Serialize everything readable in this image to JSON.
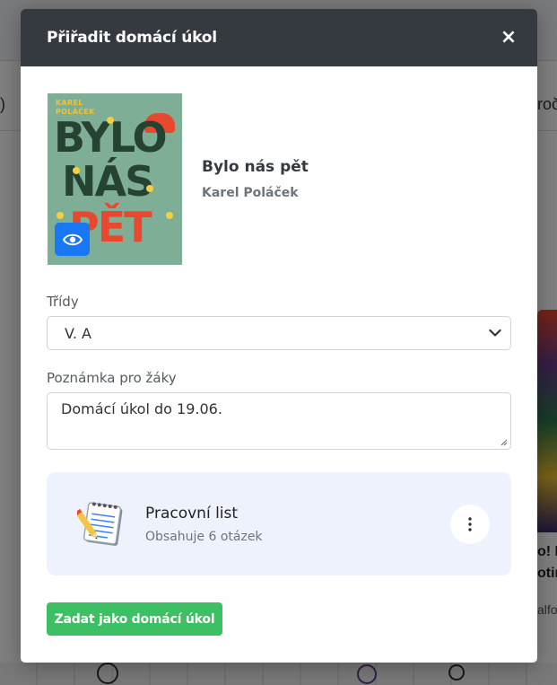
{
  "modal": {
    "title": "Přiřadit domácí úkol",
    "close_label": "×"
  },
  "book": {
    "title": "Bylo nás pět",
    "author": "Karel Poláček",
    "cover_author_line1": "KAREL",
    "cover_author_line2": "POLÁČEK",
    "cover_word1": "BYLO",
    "cover_word2": "NÁS",
    "cover_word3": "PĚT"
  },
  "form": {
    "classes_label": "Třídy",
    "classes_value": "V. A",
    "note_label": "Poznámka pro žáky",
    "note_value": "Domácí úkol do 19.06."
  },
  "worksheet": {
    "title": "Pracovní list",
    "subtitle": "Obsahuje 6 otázek"
  },
  "actions": {
    "submit_label": "Zadat jako domácí úkol"
  },
  "background": {
    "left_fragment": ")",
    "right_fragment": "roč",
    "card_title_line1": "o! P",
    "card_title_line2": "otin",
    "card_sub": "alfo"
  },
  "colors": {
    "header_bg": "#343a40",
    "primary": "#1877f2",
    "success": "#3cc063",
    "worksheet_bg": "#eef2fd"
  }
}
